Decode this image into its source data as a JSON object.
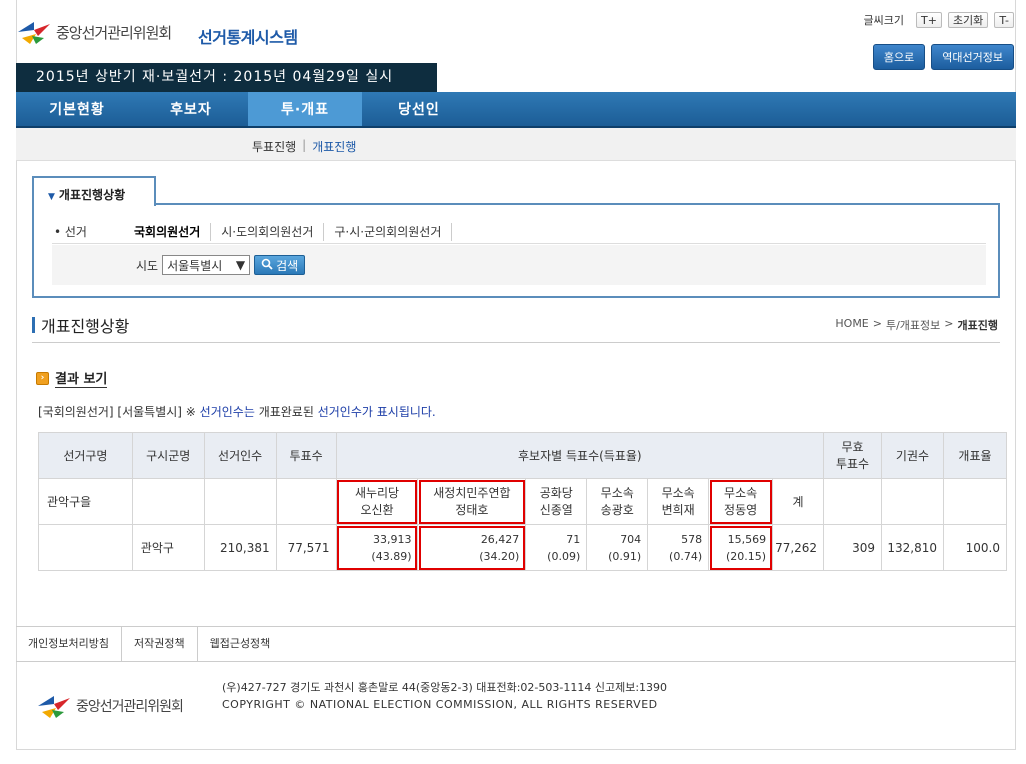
{
  "header": {
    "org_name": "중앙선거관리위원회",
    "system_title": "선거통계시스템",
    "font_size_label": "글씨크기",
    "font_size_up": "T+",
    "font_size_reset": "초기화",
    "font_size_down": "T-",
    "home_button": "홈으로",
    "history_button": "역대선거정보",
    "election_banner": "2015년 상반기 재·보궐선거 : 2015년 04월29일 실시"
  },
  "nav": {
    "items": [
      {
        "label": "기본현황"
      },
      {
        "label": "후보자"
      },
      {
        "label": "투·개표"
      },
      {
        "label": "당선인"
      }
    ],
    "active_index": 2
  },
  "subnav": {
    "items": [
      "투표진행",
      "개표진행"
    ],
    "separator": "|",
    "active_index": 1
  },
  "search": {
    "tab_label": "개표진행상황",
    "election_label": "• 선거",
    "election_options": [
      "국회의원선거",
      "시·도의회의원선거",
      "구·시·군의회의원선거"
    ],
    "selected_election": 0,
    "sido_label": "시도",
    "sido_value": "서울특별시",
    "search_button": "검색"
  },
  "section": {
    "title": "개표진행상황",
    "breadcrumb": [
      "HOME",
      "투/개표정보",
      "개표진행"
    ],
    "crumb_sep": ">",
    "result_title": "결과 보기",
    "note_prefix": "[국회의원선거] [서울특별시] ※ ",
    "note_blue1": "선거인수는",
    "note_mid": " 개표완료된 ",
    "note_blue2": "선거인수가 표시됩니다."
  },
  "table": {
    "headers": {
      "district": "선거구명",
      "sigungu": "구시군명",
      "electors": "선거인수",
      "voters": "투표수",
      "candidates_group": "후보자별 득표수(득표율)",
      "invalid": "무효\n투표수",
      "abstain": "기권수",
      "rate": "개표율"
    },
    "candidates": [
      {
        "party": "새누리당",
        "name": "오신환",
        "votes": "33,913",
        "pct": "(43.89)",
        "highlight": true
      },
      {
        "party": "새정치민주연합",
        "name": "정태호",
        "votes": "26,427",
        "pct": "(34.20)",
        "highlight": true
      },
      {
        "party": "공화당",
        "name": "신종열",
        "votes": "71",
        "pct": "(0.09)",
        "highlight": false
      },
      {
        "party": "무소속",
        "name": "송광호",
        "votes": "704",
        "pct": "(0.91)",
        "highlight": false
      },
      {
        "party": "무소속",
        "name": "변희재",
        "votes": "578",
        "pct": "(0.74)",
        "highlight": false
      },
      {
        "party": "무소속",
        "name": "정동영",
        "votes": "15,569",
        "pct": "(20.15)",
        "highlight": true
      }
    ],
    "total_label": "계",
    "row": {
      "district": "관악구을",
      "sigungu": "관악구",
      "electors": "210,381",
      "voters": "77,571",
      "total": "77,262",
      "invalid": "309",
      "abstain": "132,810",
      "rate": "100.0"
    }
  },
  "footer": {
    "links": [
      "개인정보처리방침",
      "저작권정책",
      "웹접근성정책"
    ],
    "address": "(우)427-727 경기도 과천시 홍촌말로 44(중앙동2-3) 대표전화:02-503-1114 신고제보:1390",
    "copyright": "COPYRIGHT © NATIONAL ELECTION COMMISSION, ALL RIGHTS RESERVED",
    "org_name": "중앙선거관리위원회"
  },
  "colors": {
    "brand_blue": "#1e5aa8",
    "nav_blue": "#2f79b5",
    "nav_active": "#4d9ad5",
    "banner_dark": "#0e2d3f",
    "highlight_red": "#e00000"
  }
}
